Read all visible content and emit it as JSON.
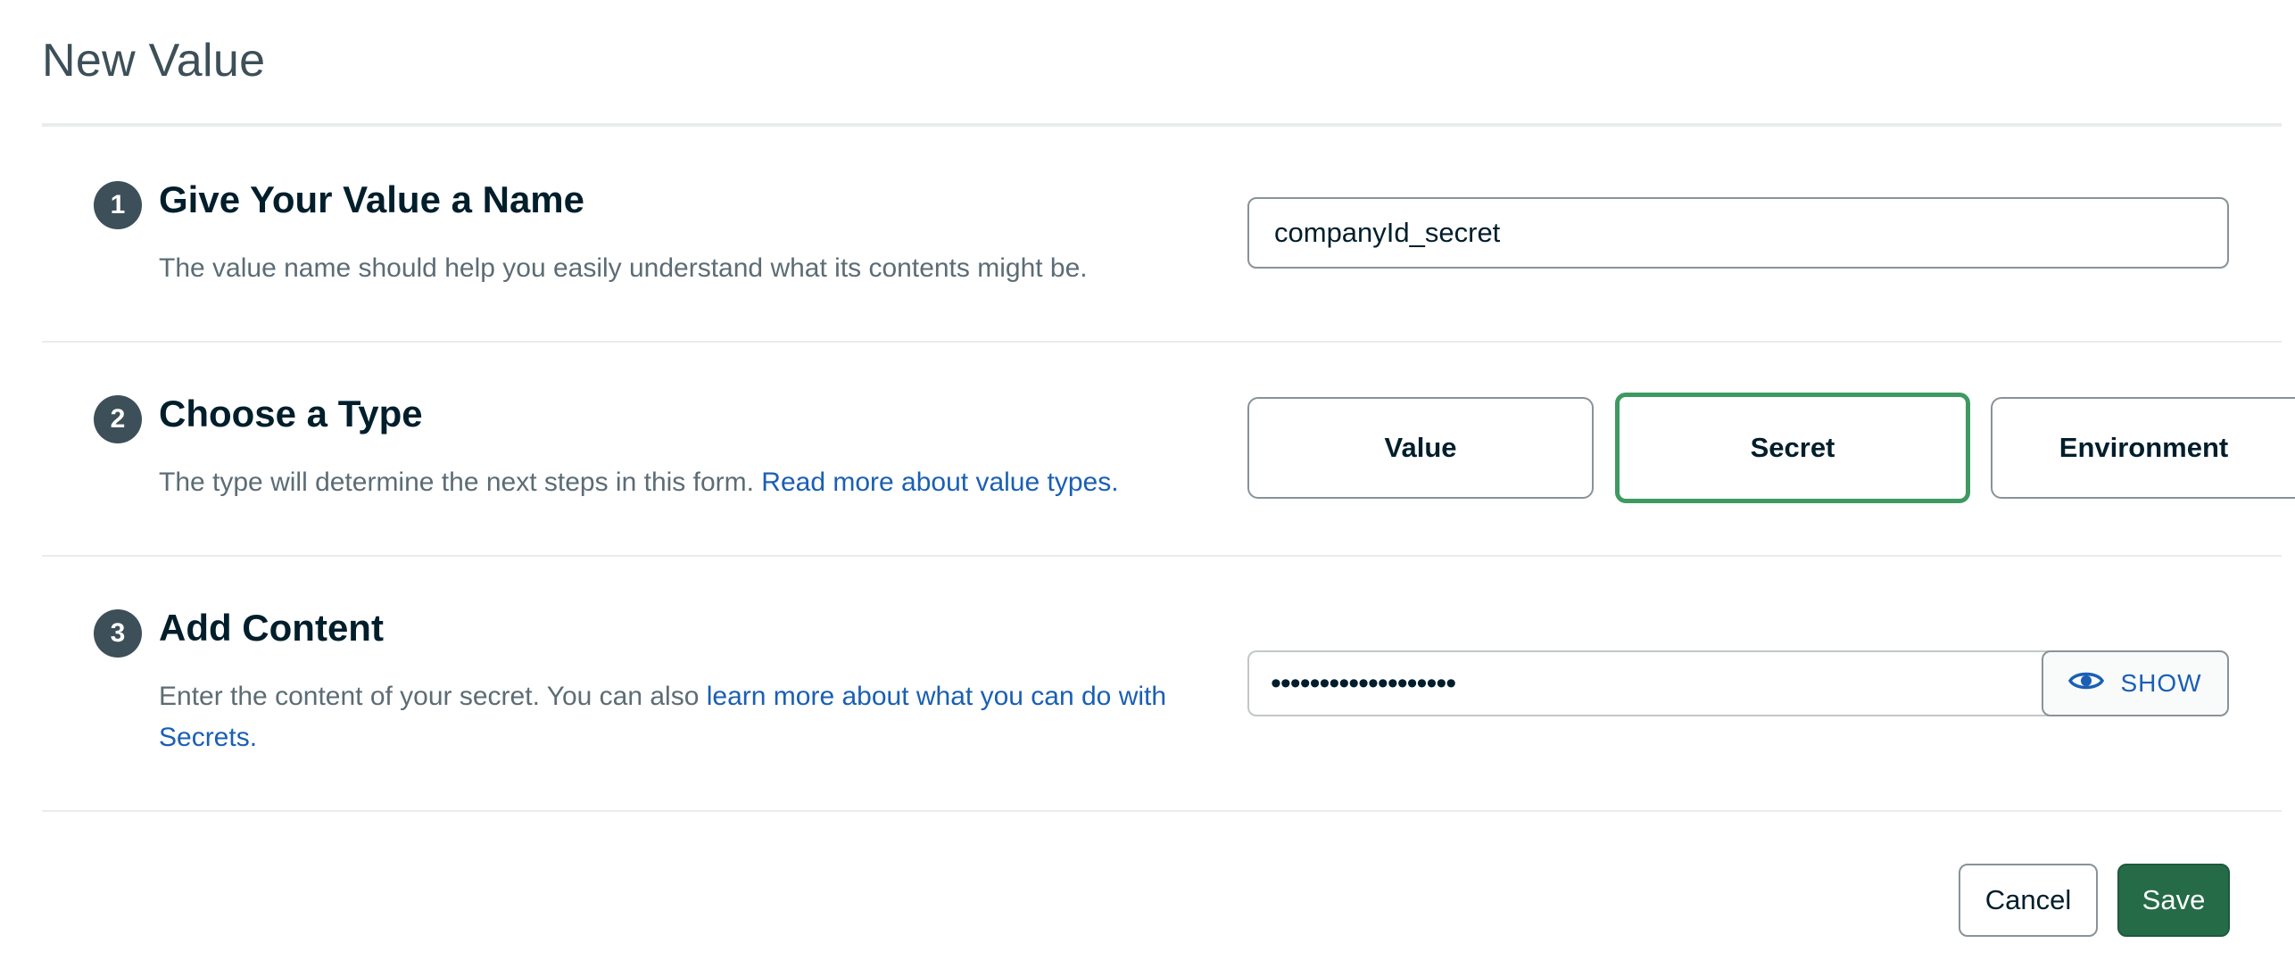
{
  "page": {
    "title": "New Value"
  },
  "steps": [
    {
      "number": "1",
      "heading": "Give Your Value a Name",
      "description": "The value name should help you easily understand what its contents might be."
    },
    {
      "number": "2",
      "heading": "Choose a Type",
      "description": "The type will determine the next steps in this form. ",
      "link": "Read more about value types."
    },
    {
      "number": "3",
      "heading": "Add Content",
      "description": "Enter the content of your secret. You can also ",
      "link": "learn more about what you can do with Secrets."
    }
  ],
  "name_input": {
    "value": "companyId_secret"
  },
  "type_options": [
    {
      "label": "Value",
      "selected": false
    },
    {
      "label": "Secret",
      "selected": true
    },
    {
      "label": "Environment",
      "selected": false
    }
  ],
  "content_input": {
    "masked_value": "•••••••••••••••••••"
  },
  "show_button": {
    "label": "SHOW",
    "icon": "eye-icon"
  },
  "footer": {
    "cancel_label": "Cancel",
    "save_label": "Save"
  },
  "colors": {
    "accent_link": "#1a5fb4",
    "selected_border": "#3d9a60",
    "save_button": "#256b48"
  }
}
